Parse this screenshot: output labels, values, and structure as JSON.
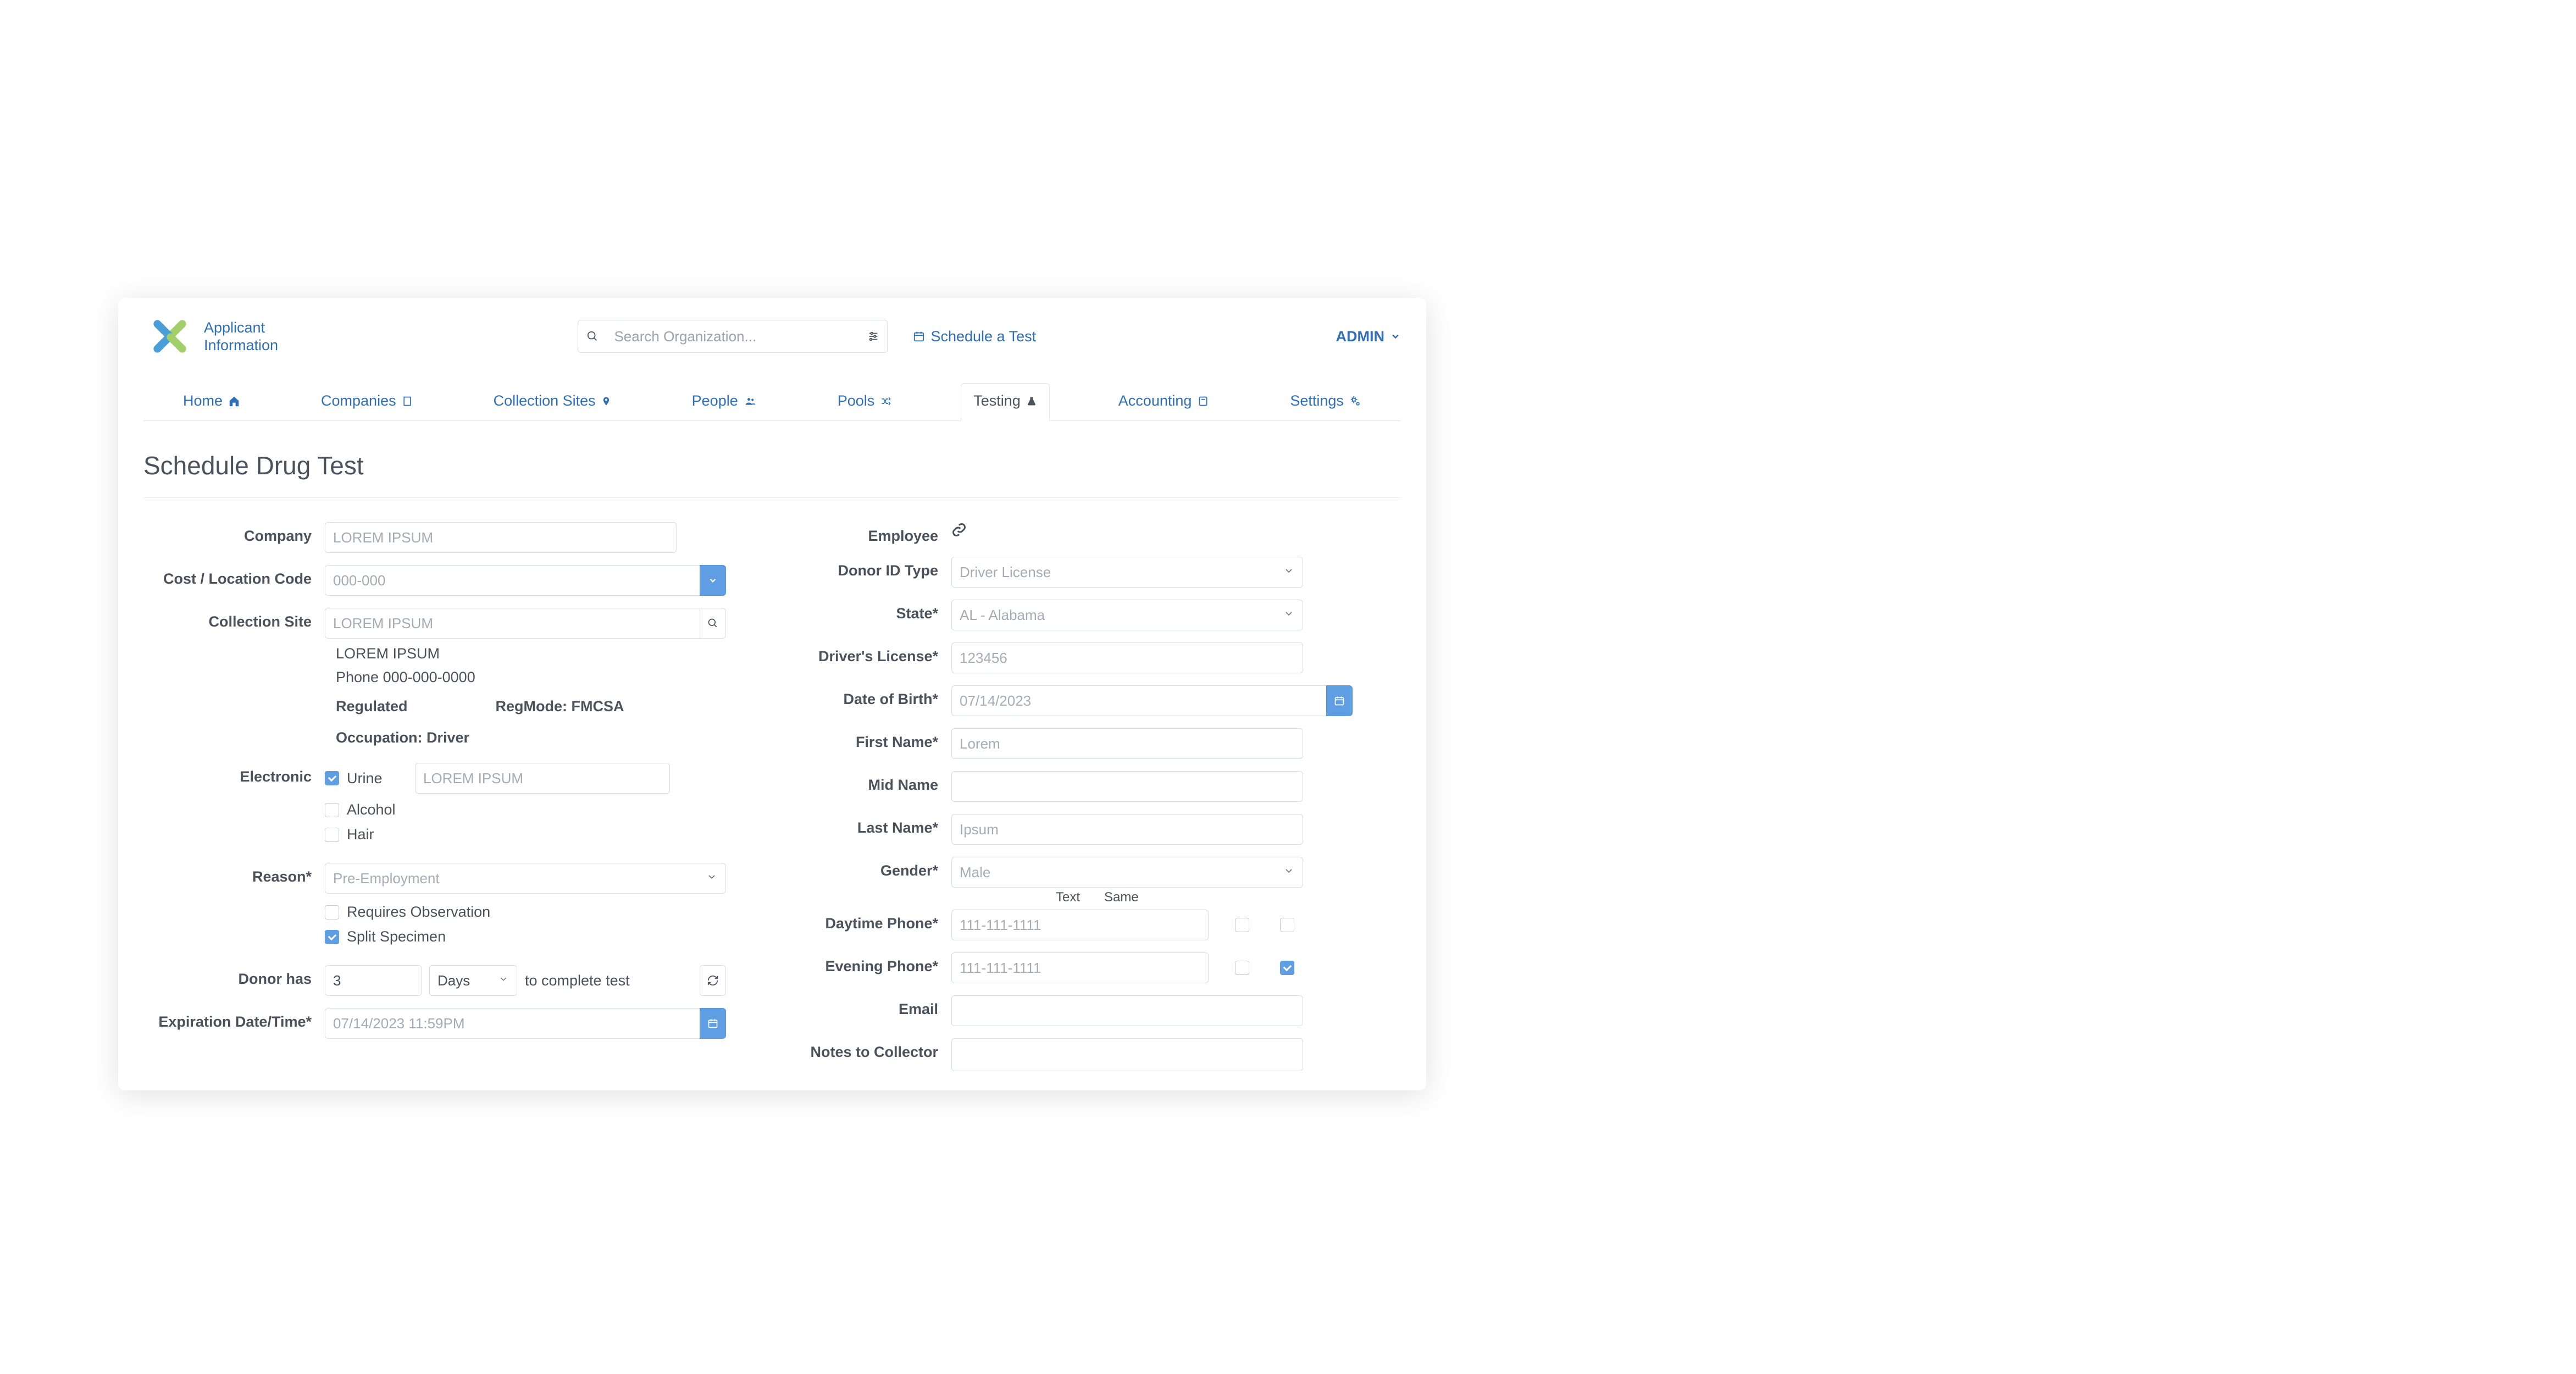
{
  "brand": {
    "line1": "Applicant",
    "line2": "Information"
  },
  "header": {
    "search_placeholder": "Search Organization...",
    "schedule_link": "Schedule a Test",
    "admin_label": "ADMIN"
  },
  "nav": {
    "home": "Home",
    "companies": "Companies",
    "collection_sites": "Collection Sites",
    "people": "People",
    "pools": "Pools",
    "testing": "Testing",
    "accounting": "Accounting",
    "settings": "Settings"
  },
  "page_title": "Schedule Drug Test",
  "left": {
    "label_company": "Company",
    "company_placeholder": "LOREM IPSUM",
    "label_cost": "Cost / Location Code",
    "cost_placeholder": "000-000",
    "label_site": "Collection Site",
    "site_placeholder": "LOREM IPSUM",
    "site_line1": "LOREM IPSUM",
    "site_line2": "Phone 000-000-0000",
    "reg_left": "Regulated",
    "reg_right": "RegMode: FMCSA",
    "occupation": "Occupation: Driver",
    "label_electronic": "Electronic",
    "ck_urine": "Urine",
    "urine_placeholder": "LOREM IPSUM",
    "ck_alcohol": "Alcohol",
    "ck_hair": "Hair",
    "label_reason": "Reason*",
    "reason_placeholder": "Pre-Employment",
    "ck_observation": "Requires Observation",
    "ck_split": "Split Specimen",
    "label_donor_has": "Donor has",
    "donor_qty": "3",
    "donor_unit": "Days",
    "donor_suffix": "to complete test",
    "label_expiration": "Expiration Date/Time*",
    "expiration_placeholder": "07/14/2023 11:59PM"
  },
  "right": {
    "label_employee": "Employee",
    "label_idtype": "Donor ID Type",
    "idtype_placeholder": "Driver License",
    "label_state": "State*",
    "state_placeholder": "AL - Alabama",
    "label_license": "Driver's License*",
    "license_placeholder": "123456",
    "label_dob": "Date of Birth*",
    "dob_placeholder": "07/14/2023",
    "label_first": "First Name*",
    "first_placeholder": "Lorem",
    "label_mid": "Mid Name",
    "label_last": "Last Name*",
    "last_placeholder": "Ipsum",
    "label_gender": "Gender*",
    "gender_placeholder": "Male",
    "phone_head_text": "Text",
    "phone_head_same": "Same",
    "label_day": "Daytime Phone*",
    "day_placeholder": "111-111-1111",
    "label_eve": "Evening Phone*",
    "eve_placeholder": "111-111-1111",
    "label_email": "Email",
    "label_notes": "Notes to Collector"
  }
}
